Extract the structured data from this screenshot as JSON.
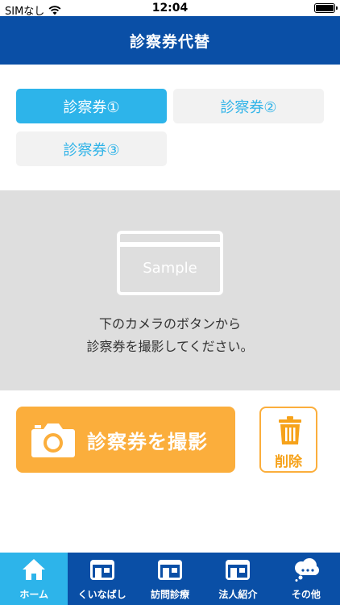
{
  "status_bar": {
    "carrier": "SIMなし",
    "time": "12:04"
  },
  "nav": {
    "title": "診察券代替"
  },
  "tabs": [
    {
      "label": "診察券①",
      "active": true
    },
    {
      "label": "診察券②",
      "active": false
    },
    {
      "label": "診察券③",
      "active": false
    }
  ],
  "preview": {
    "sample_label": "Sample",
    "instruction_line1": "下のカメラのボタンから",
    "instruction_line2": "診察券を撮影してください。"
  },
  "actions": {
    "capture_label": "診察券を撮影",
    "capture_icon": "camera-icon",
    "delete_label": "削除",
    "delete_icon": "trash-icon"
  },
  "tabbar": [
    {
      "label": "ホーム",
      "icon": "home-icon",
      "active": true
    },
    {
      "label": "くいなばし",
      "icon": "clinic-icon",
      "active": false
    },
    {
      "label": "訪問診療",
      "icon": "clinic-icon",
      "active": false
    },
    {
      "label": "法人紹介",
      "icon": "clinic-icon",
      "active": false
    },
    {
      "label": "その他",
      "icon": "more-icon",
      "active": false
    }
  ],
  "colors": {
    "primary": "#0a4fa6",
    "accent": "#2db4ea",
    "orange": "#fbae3c",
    "preview_bg": "#dedede"
  }
}
